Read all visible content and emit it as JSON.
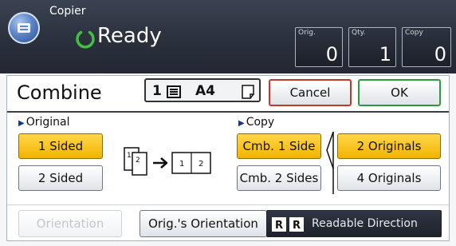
{
  "app": {
    "label": "Copier",
    "status": "Ready"
  },
  "counters": [
    {
      "label": "Orig.",
      "value": "0"
    },
    {
      "label": "Qty.",
      "value": "1"
    },
    {
      "label": "Copy",
      "value": "0"
    }
  ],
  "header": {
    "title": "Combine",
    "paper_info": {
      "page_count": "1",
      "size": "A4"
    },
    "cancel_label": "Cancel",
    "ok_label": "OK"
  },
  "original": {
    "label": "Original",
    "options": [
      "1 Sided",
      "2 Sided"
    ],
    "selected": "1 Sided"
  },
  "diagram": {
    "page1": "1",
    "page2": "2",
    "out1": "1",
    "out2": "2"
  },
  "copy": {
    "label": "Copy",
    "modes": [
      "Cmb. 1 Side",
      "Cmb. 2 Sides"
    ],
    "selected_mode": "Cmb. 1 Side",
    "counts": [
      "2 Originals",
      "4 Originals"
    ],
    "selected_count": "2 Originals"
  },
  "footer": {
    "orientation_label": "Orientation",
    "orig_orientation_label": "Orig.'s Orientation",
    "readable_direction_label": "Readable Direction"
  },
  "colors": {
    "selected": "#f3b400",
    "cancel_border": "#c0392b",
    "ok_border": "#2e9a40",
    "status_bar": "#2a303c"
  }
}
